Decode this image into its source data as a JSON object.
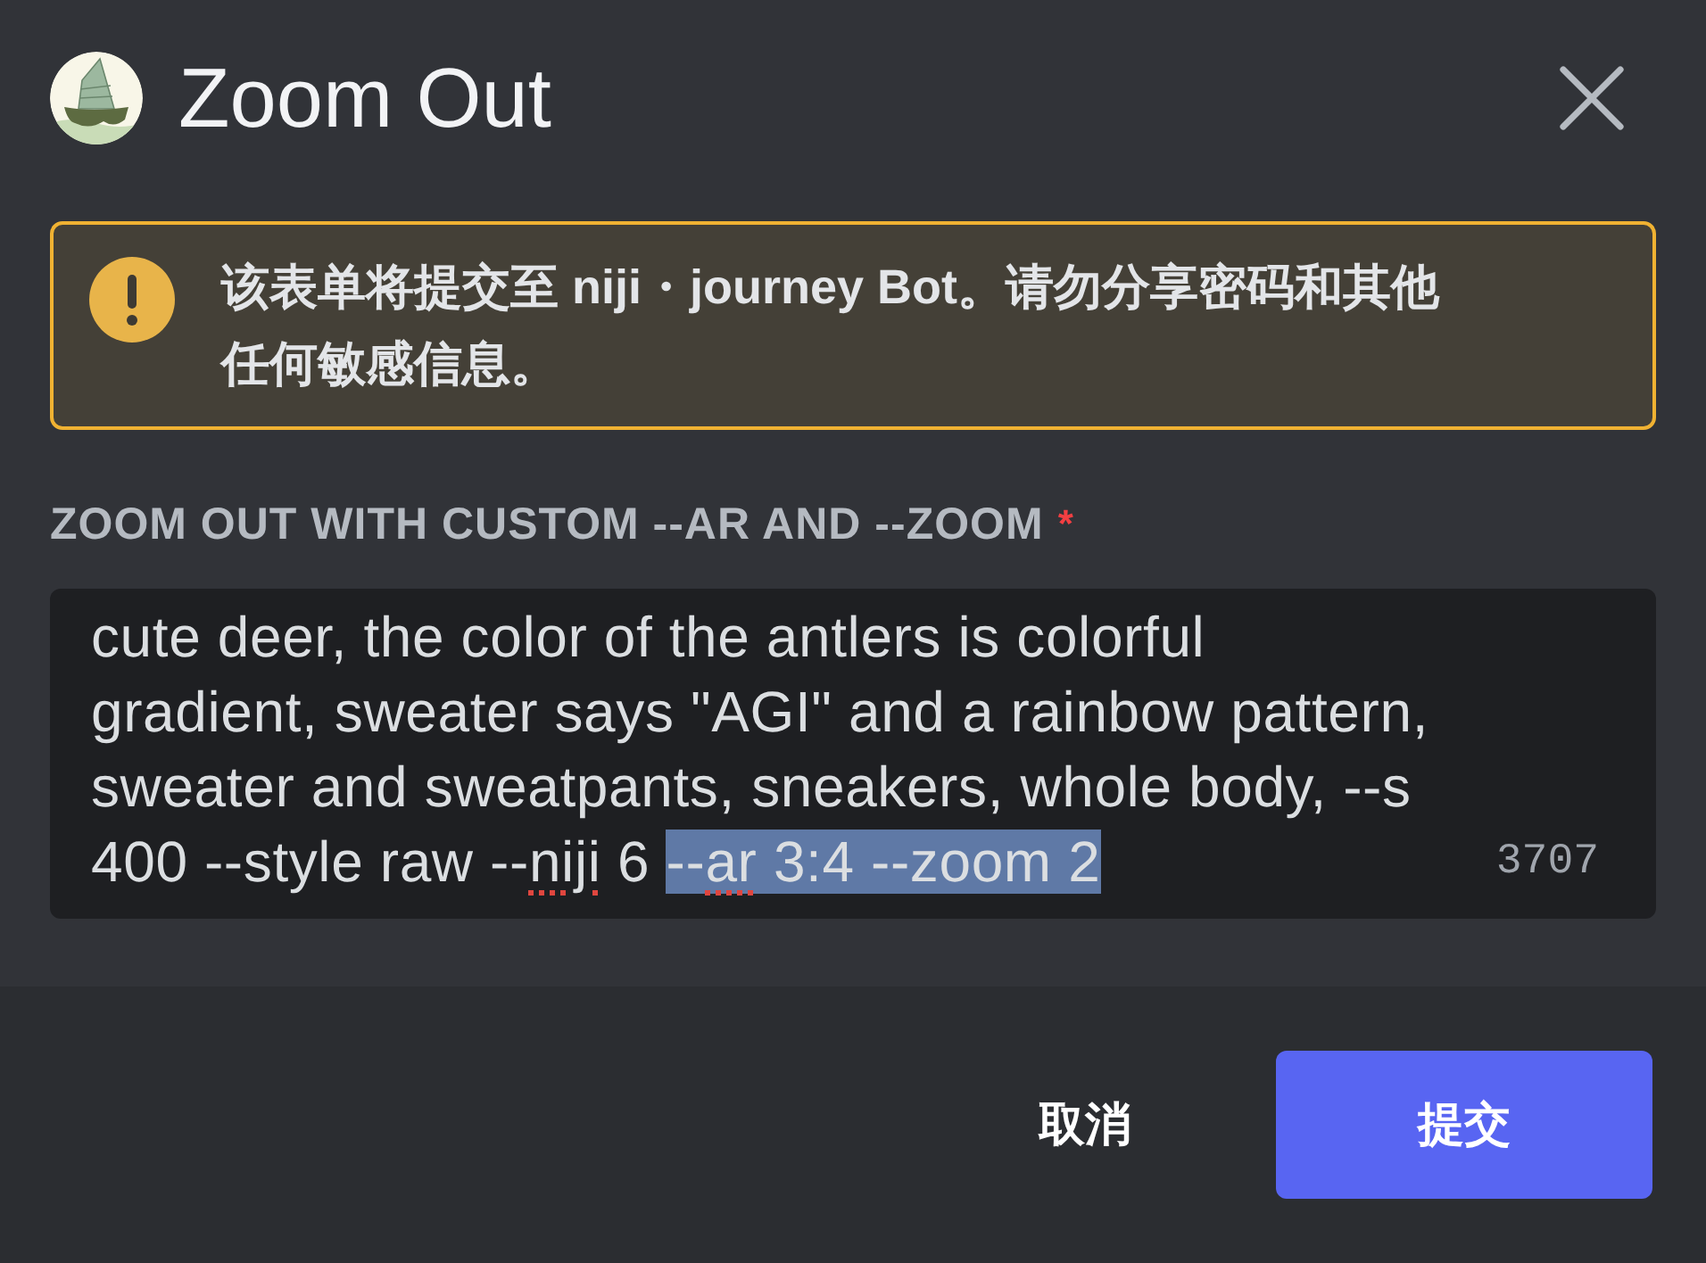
{
  "dialog": {
    "title": "Zoom Out"
  },
  "notice": {
    "text": "该表单将提交至 niji・journey Bot。请勿分享密码和其他任何敏感信息。"
  },
  "field": {
    "label": "ZOOM OUT WITH CUSTOM --AR AND --ZOOM",
    "required_mark": "*",
    "lines": [
      [
        {
          "text": "cute deer, the color of the antlers is colorful",
          "selected": false,
          "misspelled": false
        }
      ],
      [
        {
          "text": "gradient, sweater says \"AGI\" and a rainbow pattern,",
          "selected": false,
          "misspelled": false
        }
      ],
      [
        {
          "text": "sweater and sweatpants, sneakers, whole body, --s",
          "selected": false,
          "misspelled": false
        }
      ],
      [
        {
          "text": "400 --style raw --",
          "selected": false,
          "misspelled": false
        },
        {
          "text": "niji",
          "selected": false,
          "misspelled": true
        },
        {
          "text": " 6 ",
          "selected": false,
          "misspelled": false
        },
        {
          "text": "--",
          "selected": true,
          "misspelled": false
        },
        {
          "text": "ar",
          "selected": true,
          "misspelled": true
        },
        {
          "text": " 3:4 --zoom 2",
          "selected": true,
          "misspelled": false
        }
      ]
    ],
    "counter": "3707"
  },
  "buttons": [
    {
      "label": "取消",
      "kind": "secondary"
    },
    {
      "label": "提交",
      "kind": "primary"
    }
  ]
}
